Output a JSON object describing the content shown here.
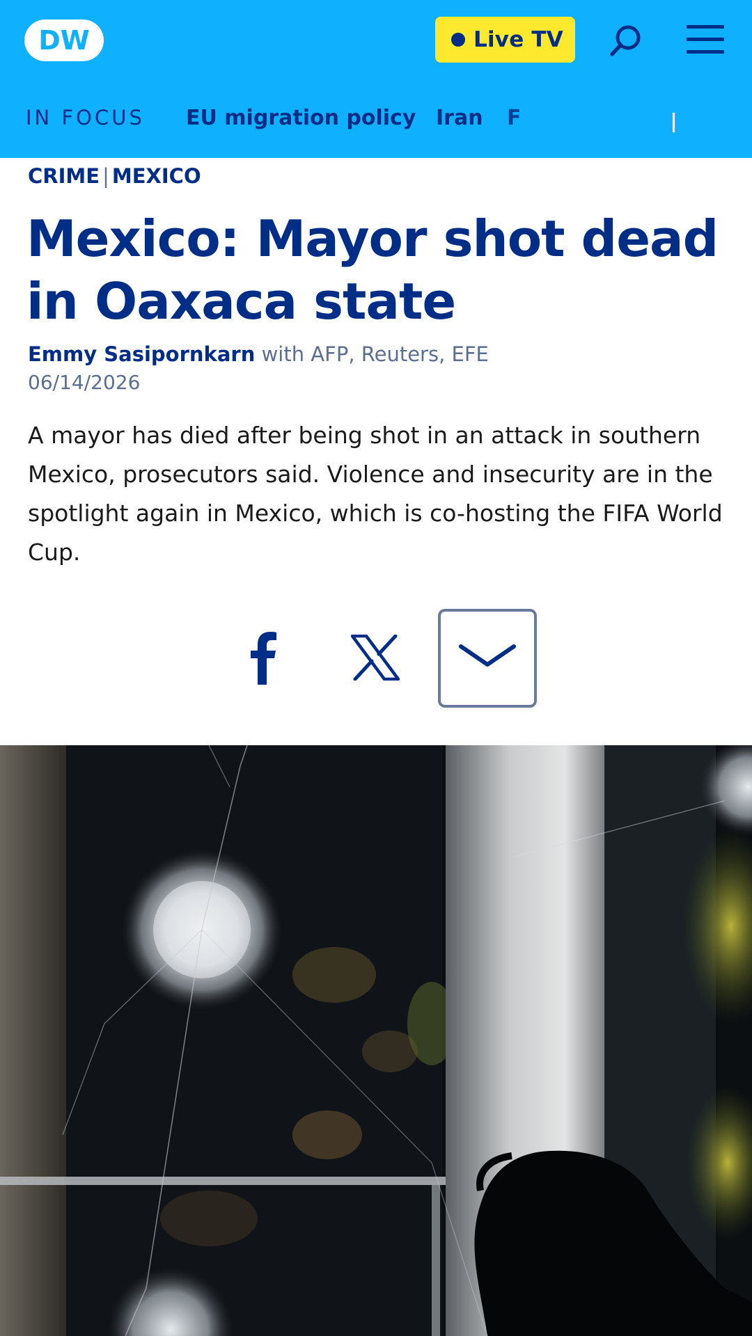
{
  "header": {
    "logo_text": "DW",
    "live_button_label": "Live TV",
    "icons": {
      "search": "search-icon",
      "menu": "hamburger-menu-icon"
    },
    "colors": {
      "header_bg": "#0fb1ff",
      "live_bg": "#ffe92e",
      "brand_dark": "#002d86"
    }
  },
  "focus_nav": {
    "label": "IN FOCUS",
    "links": [
      "EU migration policy",
      "Iran",
      "F"
    ]
  },
  "article": {
    "categories": [
      "CRIME",
      "MEXICO"
    ],
    "headline": "Mexico: Mayor shot dead in Oaxaca state",
    "author": "Emmy Sasipornkarn",
    "agencies": "with AFP, Reuters, EFE",
    "date": "06/14/2026",
    "teaser": "A mayor has died after being shot in an attack in southern Mexico, prosecutors said. Violence and insecurity are in the spotlight again in Mexico, which is co-hosting the FIFA World Cup."
  },
  "share": {
    "icons": [
      "facebook-icon",
      "x-icon",
      "chevron-down-icon"
    ]
  }
}
